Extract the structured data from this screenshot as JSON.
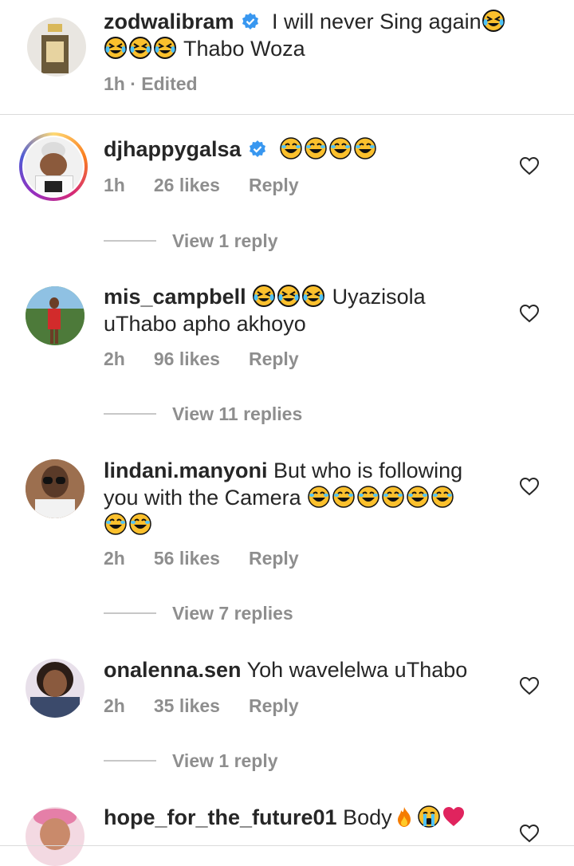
{
  "caption": {
    "username": "zodwalibram",
    "text_a": "I will never Sing again",
    "text_b": "Thabo Woza",
    "time": "1h",
    "edited": "Edited"
  },
  "comments": [
    {
      "username": "djhappygalsa",
      "text": "",
      "time": "1h",
      "likes": "26 likes",
      "reply": "Reply",
      "view_replies": "View 1 reply"
    },
    {
      "username": "mis_campbell",
      "text": "Uyazisola",
      "text2": "uThabo apho akhoyo",
      "time": "2h",
      "likes": "96 likes",
      "reply": "Reply",
      "view_replies": "View 11 replies"
    },
    {
      "username": "lindani.manyoni",
      "text": "But who is following",
      "text2": "you with the Camera",
      "time": "2h",
      "likes": "56 likes",
      "reply": "Reply",
      "view_replies": "View 7 replies"
    },
    {
      "username": "onalenna.sen",
      "text": "Yoh wavelelwa uThabo",
      "time": "2h",
      "likes": "35 likes",
      "reply": "Reply",
      "view_replies": "View 1 reply"
    },
    {
      "username": "hope_for_the_future01",
      "text": "Body"
    }
  ],
  "colors": {
    "verified": "#3897f0",
    "muted": "#8e8e8e",
    "emoji": "#fbc02d",
    "heart_red": "#e0245e"
  },
  "icons": [
    "verified-badge-icon",
    "rofl-emoji-icon",
    "joy-emoji-icon",
    "fire-emoji-icon",
    "crying-emoji-icon",
    "red-heart-emoji-icon",
    "like-heart-icon"
  ]
}
